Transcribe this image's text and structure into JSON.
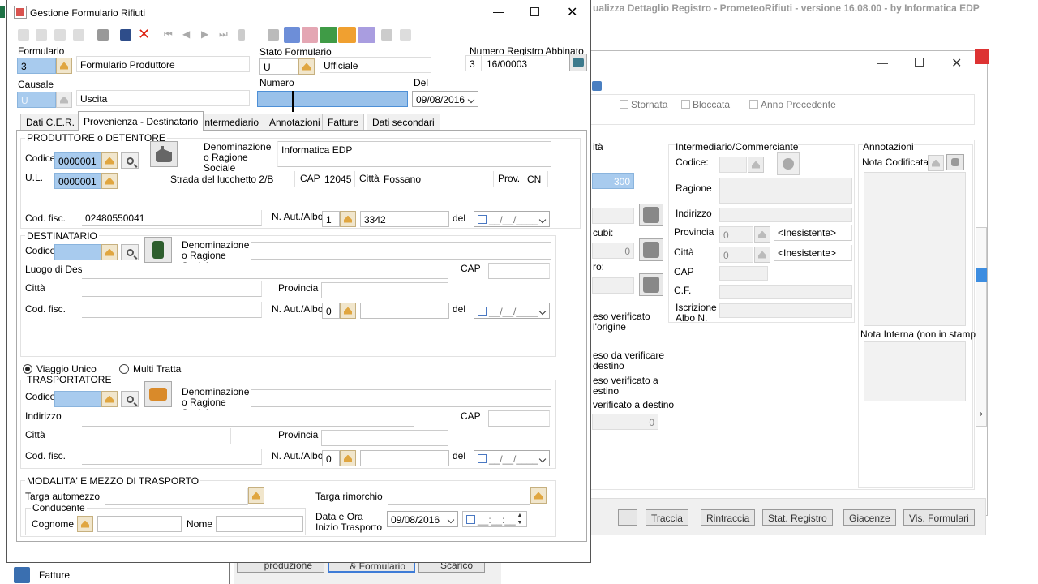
{
  "bg_window": {
    "title": "ualizza Dettaglio Registro - PrometeoRifiuti - versione 16.08.00 - by Informatica EDP",
    "checks": [
      "Stornata",
      "Bloccata",
      "Anno Precedente"
    ],
    "section_ita": "ità",
    "field_300": "300",
    "label_cubi": "cubi:",
    "val_zero1": "0",
    "label_ro": "ro:",
    "labels_peso": [
      "eso verificato",
      "l'origine",
      "eso da verificare",
      "destino",
      "eso verificato a",
      "estino",
      "verificato a destino"
    ],
    "val_zero2": "0",
    "intermediario": {
      "title": "Intermediario/Commerciante",
      "codice": "Codice:",
      "ragione": "Ragione",
      "indirizzo": "Indirizzo",
      "provincia": "Provincia",
      "prov_val": "0",
      "prov_text": "<Inesistente>",
      "citta": "Città",
      "citta_val": "0",
      "citta_text": "<Inesistente>",
      "cap": "CAP",
      "cf": "C.F.",
      "iscrizione": "Iscrizione Albo N."
    },
    "annotazioni": {
      "title": "Annotazioni",
      "nota_cod": "Nota Codificata:",
      "nota_int": "Nota Interna (non in stampa)"
    },
    "bottom_buttons": [
      "Traccia",
      "Rintraccia",
      "Stat. Registro",
      "Giacenze",
      "Vis. Formulari"
    ],
    "bottom_tabs": [
      "produzione",
      "& Formulario",
      "Scarico"
    ]
  },
  "taskbar": {
    "fatture": "Fatture"
  },
  "win": {
    "title": "Gestione Formulario Rifiuti",
    "formulario_label": "Formulario",
    "formulario_code": "3",
    "formulario_name": "Formulario Produttore",
    "stato_label": "Stato Formulario",
    "stato_code": "U",
    "stato_name": "Ufficiale",
    "numreg_label": "Numero Registro Abbinato",
    "numreg_a": "3",
    "numreg_b": "16/00003",
    "causale_label": "Causale",
    "causale_code": "U",
    "causale_name": "Uscita",
    "numero_label": "Numero",
    "numero_value": "",
    "del_label": "Del",
    "del_value": "09/08/2016",
    "tabs": [
      "Dati C.E.R.",
      "Provenienza - Destinatario",
      "Intermediario",
      "Annotazioni",
      "Fatture",
      "Dati secondari"
    ],
    "produttore": {
      "title": "PRODUTTORE o DETENTORE",
      "codice_label": "Codice",
      "codice": "0000001",
      "denom_label": "Denominazione o Ragione Sociale",
      "denom": "Informatica EDP",
      "ul_label": "U.L.",
      "ul": "0000001",
      "indirizzo": "Strada del lucchetto 2/B",
      "cap_label": "CAP",
      "cap": "12045",
      "citta_label": "Città",
      "citta": "Fossano",
      "prov_label": "Prov.",
      "prov": "CN",
      "codfisc_label": "Cod. fisc.",
      "codfisc": "02480550041",
      "naut_label": "N. Aut./Albo",
      "naut_a": "1",
      "naut_b": "3342",
      "del_label": "del",
      "date_mask": "__/__/____"
    },
    "destinatario": {
      "title": "DESTINATARIO",
      "codice_label": "Codice",
      "denom_label": "Denominazione o Ragione Sociale",
      "luogo_label": "Luogo di Dest.",
      "cap_label": "CAP",
      "citta_label": "Città",
      "provincia_label": "Provincia",
      "codfisc_label": "Cod. fisc.",
      "naut_label": "N. Aut./Albo",
      "naut_a": "0",
      "del_label": "del",
      "date_mask": "__/__/____"
    },
    "viaggio": {
      "unico": "Viaggio Unico",
      "multi": "Multi Tratta"
    },
    "trasportatore": {
      "title": "TRASPORTATORE",
      "codice_label": "Codice",
      "denom_label": "Denominazione o Ragione Sociale",
      "indirizzo_label": "Indirizzo",
      "cap_label": "CAP",
      "citta_label": "Città",
      "provincia_label": "Provincia",
      "codfisc_label": "Cod. fisc.",
      "naut_label": "N. Aut./Albo",
      "naut_a": "0",
      "del_label": "del",
      "date_mask": "__/__/____"
    },
    "modalita": {
      "title": "MODALITA' E MEZZO DI TRASPORTO",
      "targa_auto": "Targa automezzo",
      "targa_rim": "Targa rimorchio",
      "conducente": "Conducente",
      "cognome": "Cognome",
      "nome": "Nome",
      "data_ora_label": "Data e Ora Inizio Trasporto",
      "data": "09/08/2016",
      "ora_mask": "__:__:__"
    }
  }
}
